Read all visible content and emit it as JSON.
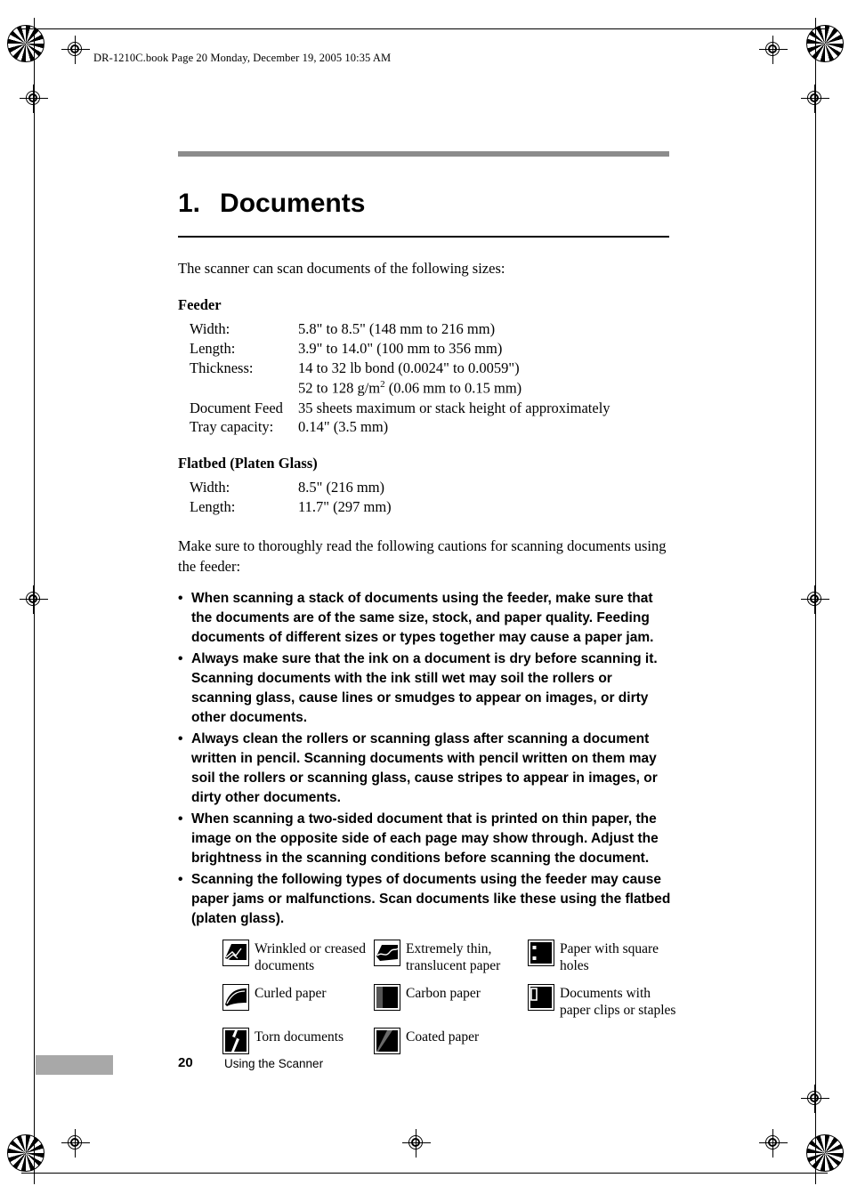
{
  "file_header": "DR-1210C.book  Page 20  Monday, December 19, 2005  10:35 AM",
  "chapter": {
    "number": "1.",
    "title": "Documents"
  },
  "intro": "The scanner can scan documents of the following sizes:",
  "feeder": {
    "heading": "Feeder",
    "rows": [
      {
        "label": "Width:",
        "value": "5.8\" to 8.5\" (148 mm to 216 mm)"
      },
      {
        "label": "Length:",
        "value": "3.9\" to 14.0\" (100 mm to 356 mm)"
      },
      {
        "label": "Thickness:",
        "value": "14 to 32 lb bond (0.0024\" to 0.0059\")"
      },
      {
        "label": "",
        "value_pre": "52 to 128 g/m",
        "value_sup": "2",
        "value_post": " (0.06 mm to 0.15 mm)"
      },
      {
        "label": "Document Feed",
        "value": "35 sheets maximum or stack height of approximately"
      },
      {
        "label": "Tray capacity:",
        "value": "0.14\" (3.5 mm)"
      }
    ]
  },
  "flatbed": {
    "heading": "Flatbed (Platen Glass)",
    "rows": [
      {
        "label": "Width:",
        "value": "8.5\" (216 mm)"
      },
      {
        "label": "Length:",
        "value": "11.7\" (297 mm)"
      }
    ]
  },
  "caution_intro": "Make sure to thoroughly read the following cautions for scanning documents using the feeder:",
  "bullet_char": "•",
  "cautions": [
    "When scanning a stack of documents using the feeder, make sure that the documents are of the same size, stock, and paper quality. Feeding documents of different sizes or types together may cause a paper jam.",
    "Always make sure that the ink on a document is dry before scanning it. Scanning documents with the ink still wet may soil the rollers or scanning glass, cause lines or smudges to appear on images, or dirty other documents.",
    "Always clean the rollers or scanning glass after scanning a document written in pencil. Scanning documents with pencil written on them may soil the rollers or scanning glass, cause stripes to appear in images, or dirty other documents.",
    "When scanning a two-sided document that is printed on thin paper, the image on the opposite side of each page may show through. Adjust the brightness in the scanning conditions before scanning the document.",
    "Scanning the following types of documents using the feeder may cause paper jams or malfunctions. Scan documents like these using the flatbed (platen glass)."
  ],
  "document_types": [
    {
      "icon": "wrinkled-document-icon",
      "label": "Wrinkled or creased documents"
    },
    {
      "icon": "thin-translucent-paper-icon",
      "label": "Extremely thin, translucent paper"
    },
    {
      "icon": "square-hole-paper-icon",
      "label": "Paper with square holes"
    },
    {
      "icon": "curled-paper-icon",
      "label": "Curled paper"
    },
    {
      "icon": "carbon-paper-icon",
      "label": "Carbon paper"
    },
    {
      "icon": "paper-clip-document-icon",
      "label": "Documents with paper clips or staples"
    },
    {
      "icon": "torn-document-icon",
      "label": "Torn documents"
    },
    {
      "icon": "coated-paper-icon",
      "label": "Coated paper"
    }
  ],
  "footer": {
    "page_number": "20",
    "section": "Using the Scanner"
  }
}
